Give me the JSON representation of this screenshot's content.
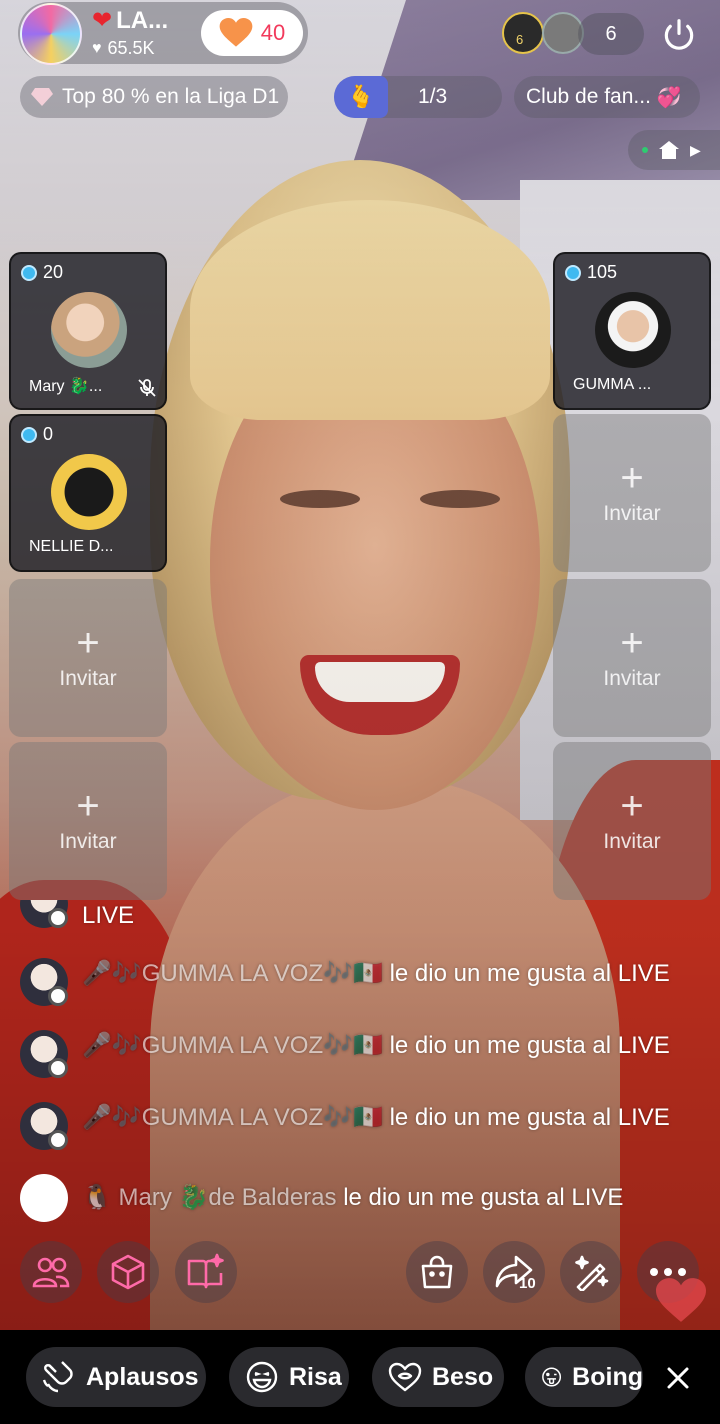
{
  "host": {
    "name": "LA...",
    "likes": "65.5K",
    "follow_count": "40"
  },
  "viewers": {
    "count": "6",
    "avatar_badge": "6"
  },
  "badges": {
    "league": "Top 80 % en la Liga D1",
    "gift_progress": "1/3",
    "fan_club": "Club de fan..."
  },
  "guests": {
    "left": [
      {
        "score": "20",
        "name": "Mary 🐉...",
        "muted": true
      },
      {
        "score": "0",
        "name": "NELLIE D..."
      }
    ],
    "right": [
      {
        "score": "105",
        "name": "GUMMA ..."
      }
    ],
    "invite_label": "Invitar"
  },
  "comments": [
    {
      "user": "",
      "message": "LIVE"
    },
    {
      "user": "🎤🎶GUMMA LA VOZ🎶🇲🇽",
      "message": " le dio un me gusta al LIVE"
    },
    {
      "user": "🎤🎶GUMMA LA VOZ🎶🇲🇽",
      "message": " le dio un me gusta al LIVE"
    },
    {
      "user": "🎤🎶GUMMA LA VOZ🎶🇲🇽",
      "message": " le dio un me gusta al LIVE"
    },
    {
      "user": "🐧 Mary 🐉de Balderas",
      "message": " le dio un me gusta al LIVE"
    }
  ],
  "actions": {
    "share_count": "10"
  },
  "reactions": [
    {
      "label": "Aplausos",
      "icon": "clap-icon"
    },
    {
      "label": "Risa",
      "icon": "laugh-icon"
    },
    {
      "label": "Beso",
      "icon": "kiss-icon"
    },
    {
      "label": "Boing",
      "icon": "tongue-icon"
    }
  ],
  "colors": {
    "accent": "#f23a5c",
    "tiktok_blue": "#3fb9f0",
    "gift_blue": "#5b6ad6"
  }
}
